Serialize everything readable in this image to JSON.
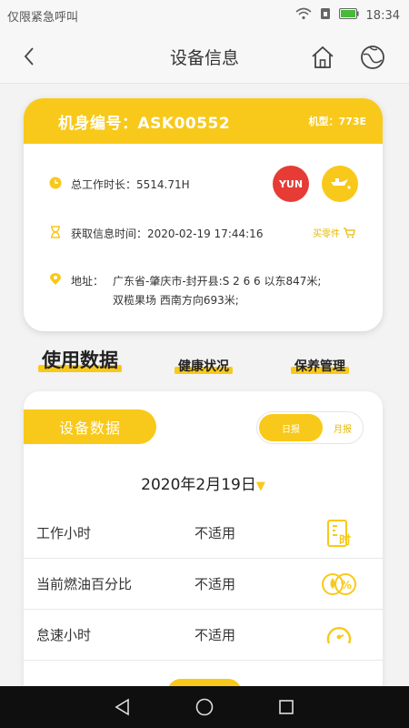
{
  "status_bar": {
    "carrier": "仅限紧急呼叫",
    "time": "18:34"
  },
  "nav": {
    "title": "设备信息"
  },
  "machine": {
    "id_label": "机身编号：ASK00552",
    "model_label": "机型：773E",
    "work_hours": "总工作时长：5514.71H",
    "info_time": "获取信息时间：2020-02-19 17:44:16",
    "buy_link": "买零件",
    "address_label": "地址：",
    "address_line1": "广东省-肇庆市-封开县:S 2 6 6 以东847米;",
    "address_line2": "双榄果场 西南方向693米;",
    "badge_red": "YUN",
    "colors": {
      "accent": "#f8c91a",
      "badge_red": "#e63c35"
    }
  },
  "tabs": [
    {
      "label": "使用数据"
    },
    {
      "label": "健康状况"
    },
    {
      "label": "保养管理"
    }
  ],
  "data_card": {
    "pill": "设备数据",
    "toggle_day": "日报",
    "toggle_month": "月报",
    "date": "2020年2月19日"
  },
  "metrics": [
    {
      "name": "工作小时",
      "value": "不适用",
      "icon": "work-hours-icon"
    },
    {
      "name": "当前燃油百分比",
      "value": "不适用",
      "icon": "fuel-percent-icon"
    },
    {
      "name": "怠速小时",
      "value": "不适用",
      "icon": "idle-gauge-icon"
    }
  ]
}
